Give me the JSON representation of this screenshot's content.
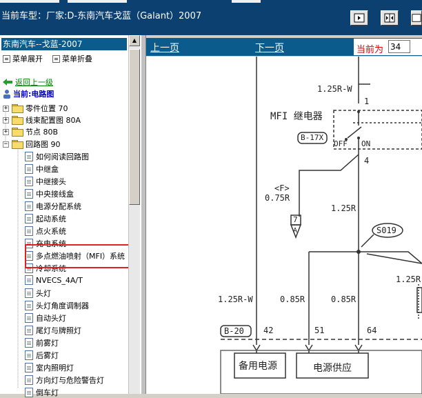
{
  "header": {
    "title": "当前车型：厂家:D-东南汽车戈蓝（Galant）2007"
  },
  "sidebar": {
    "header": "东南汽车--戈蓝-2007",
    "menu_expand": "菜单展开",
    "menu_collapse": "菜单折叠",
    "back_label": "返回上一级",
    "current_label": "当前:电路图",
    "folders": [
      {
        "label": "零件位置 70"
      },
      {
        "label": "线束配置图 80A"
      },
      {
        "label": "节点 80B"
      },
      {
        "label": "回路图 90"
      }
    ],
    "docs": [
      {
        "label": "如何阅读回路图"
      },
      {
        "label": "中继盒"
      },
      {
        "label": "中继接头"
      },
      {
        "label": "中央接线盒"
      },
      {
        "label": "电源分配系统"
      },
      {
        "label": "起动系统"
      },
      {
        "label": "点火系统"
      },
      {
        "label": "充电系统"
      },
      {
        "label": "多点燃油喷射（MFI）系统"
      },
      {
        "label": "冷却系统"
      },
      {
        "label": "NVECS_4A/T"
      },
      {
        "label": "头灯"
      },
      {
        "label": "头灯角度调制器"
      },
      {
        "label": "自动头灯"
      },
      {
        "label": "尾灯与牌照灯"
      },
      {
        "label": "前雾灯"
      },
      {
        "label": "后雾灯"
      },
      {
        "label": "室内照明灯"
      },
      {
        "label": "方向灯与危险警告灯"
      },
      {
        "label": "倒车灯"
      }
    ]
  },
  "nav": {
    "prev": "上一页",
    "next": "下一页",
    "current_label": "当前为",
    "current_page": "34"
  },
  "diagram": {
    "labels": {
      "w1": "1.25R-W",
      "pin1": "1",
      "relay": "MFI 继电器",
      "b17x": "B-17X",
      "off": "OFF",
      "on": "ON",
      "pin4": "4",
      "f": "<F>",
      "w075": "0.75R",
      "w125a": "1.25R",
      "c7": "7",
      "ca": "A",
      "s019": "S019",
      "w125b": "1.25R",
      "w125rw2": "1.25R-W",
      "w085a": "0.85R",
      "w085b": "0.85R",
      "b20": "B-20",
      "p42": "42",
      "p51": "51",
      "p64": "64",
      "backup": "备用电源",
      "power": "电源供应"
    }
  }
}
